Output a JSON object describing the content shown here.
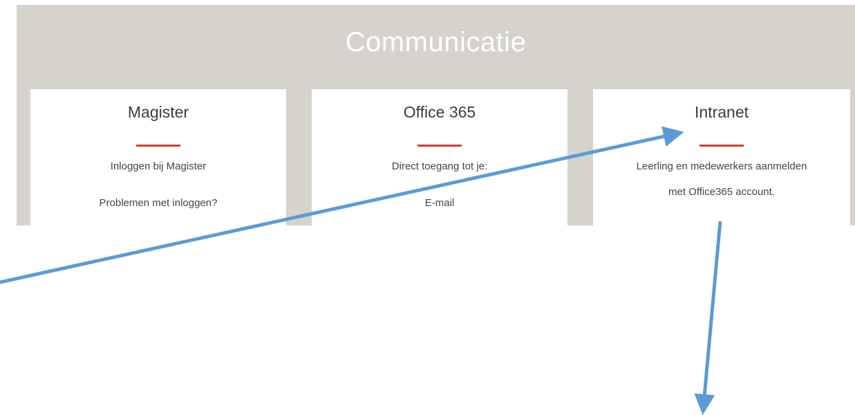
{
  "section": {
    "title": "Communicatie"
  },
  "cards": [
    {
      "title": "Magister",
      "lines": [
        "Inloggen bij Magister",
        "Problemen met inloggen?"
      ]
    },
    {
      "title": "Office 365",
      "lines": [
        "Direct toegang tot je:",
        "E-mail"
      ]
    },
    {
      "title": "Intranet",
      "lines": [
        "Leerling en medewerkers aanmelden",
        "met Office365 account."
      ]
    }
  ],
  "colors": {
    "section_background": "#d5d3cb",
    "card_background": "#ffffff",
    "divider_accent": "#d63b2f",
    "annotation_arrow": "#5b9bd5"
  }
}
